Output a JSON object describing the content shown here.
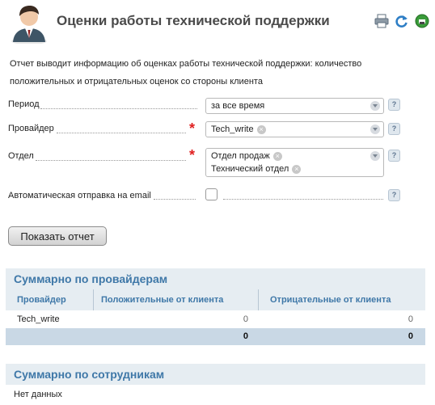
{
  "page": {
    "title": "Оценки работы технической поддержки"
  },
  "description": "Отчет выводит информацию об оценках работы технической поддержки: количество положительных и отрицательных оценок со стороны клиента",
  "toolbar": {
    "icons": [
      "printer-icon",
      "refresh-icon",
      "export-icon"
    ]
  },
  "form": {
    "period": {
      "label": "Период",
      "value": "за все время"
    },
    "provider": {
      "label": "Провайдер",
      "chips": [
        "Tech_write"
      ]
    },
    "department": {
      "label": "Отдел",
      "chips": [
        "Отдел продаж",
        "Технический отдел"
      ]
    },
    "auto_email": {
      "label": "Автоматическая отправка на email",
      "checked": false
    },
    "help_glyph": "?",
    "required_mark": "*"
  },
  "submit_label": "Показать отчет",
  "summary_providers": {
    "title": "Суммарно по провайдерам",
    "columns": [
      "Провайдер",
      "Положительные от клиента",
      "Отрицательные от клиента"
    ],
    "rows": [
      {
        "provider": "Tech_write",
        "positive": "0",
        "negative": "0"
      }
    ],
    "totals": {
      "positive": "0",
      "negative": "0"
    }
  },
  "summary_employees": {
    "title": "Суммарно по сотрудникам",
    "empty": "Нет данных"
  },
  "colors": {
    "accent": "#3f78a8",
    "section_bg": "#e6edf2",
    "totals_bg": "#c9d8e5",
    "required": "#e02020"
  }
}
